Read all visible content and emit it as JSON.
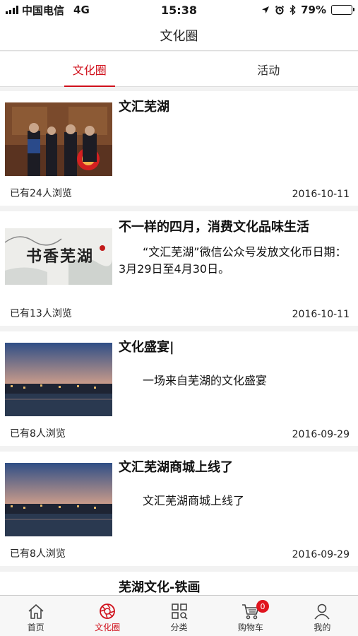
{
  "status_bar": {
    "carrier": "中国电信",
    "network": "4G",
    "time": "15:38",
    "battery": "79%",
    "battery_level": 0.79,
    "icons": [
      "signal-icon",
      "location-arrow-icon",
      "alarm-icon",
      "bluetooth-icon",
      "battery-icon"
    ]
  },
  "nav": {
    "title": "文化圈"
  },
  "tabs": [
    {
      "label": "文化圈",
      "active": true
    },
    {
      "label": "活动",
      "active": false
    }
  ],
  "feed": [
    {
      "title": "文汇芜湖",
      "description": "",
      "views": "已有24人浏览",
      "date": "2016-10-11",
      "image": "photo-ceremony"
    },
    {
      "title": "不一样的四月，消费文化品味生活",
      "description": "“文汇芜湖”微信公众号发放文化币日期：3月29日至4月30日。",
      "views": "已有13人浏览",
      "date": "2016-10-11",
      "image": "poster-shuxiang"
    },
    {
      "title": "文化盛宴|",
      "description": "一场来自芜湖的文化盛宴",
      "views": "已有8人浏览",
      "date": "2016-09-29",
      "image": "photo-city-night"
    },
    {
      "title": "文汇芜湖商城上线了",
      "description": "文汇芜湖商城上线了",
      "views": "已有8人浏览",
      "date": "2016-09-29",
      "image": "photo-city-night"
    },
    {
      "title": "芜湖文化-铁画"
    }
  ],
  "thumb_texts": {
    "poster_calligraphy": "书香芜湖"
  },
  "tab_bar": {
    "items": [
      {
        "label": "首页",
        "icon": "home-icon",
        "active": false
      },
      {
        "label": "文化圈",
        "icon": "aperture-icon",
        "active": true
      },
      {
        "label": "分类",
        "icon": "category-grid-icon",
        "active": false
      },
      {
        "label": "购物车",
        "icon": "cart-icon",
        "active": false,
        "badge": "0"
      },
      {
        "label": "我的",
        "icon": "user-icon",
        "active": false
      }
    ]
  },
  "colors": {
    "accent": "#d0101b",
    "badge": "#e0141e",
    "background": "#f2f2f2"
  }
}
